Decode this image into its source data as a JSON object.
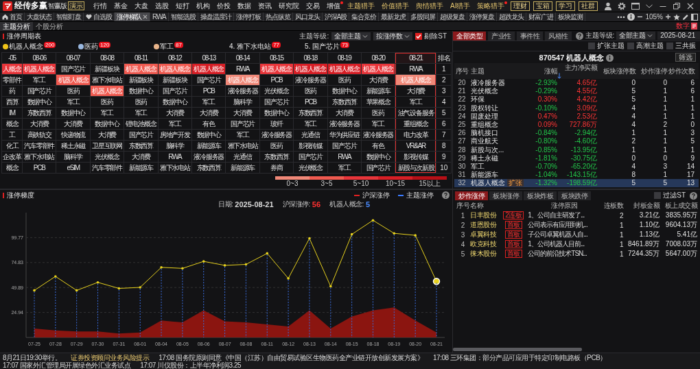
{
  "app": {
    "brand": "经传多赢",
    "edition": "智赢版",
    "demo": "演示"
  },
  "menu": [
    {
      "label": "行情",
      "gold": false,
      "dot": false
    },
    {
      "label": "基金",
      "gold": false,
      "dot": false
    },
    {
      "label": "大盘",
      "gold": false,
      "dot": false
    },
    {
      "label": "选股",
      "gold": false,
      "dot": false
    },
    {
      "label": "短打",
      "gold": false,
      "dot": false
    },
    {
      "label": "机构",
      "gold": false,
      "dot": false
    },
    {
      "label": "价投",
      "gold": false,
      "dot": false
    },
    {
      "label": "数据",
      "gold": false,
      "dot": false
    },
    {
      "label": "资讯",
      "gold": false,
      "dot": false
    },
    {
      "label": "研究院",
      "gold": false,
      "dot": false
    },
    {
      "label": "交易",
      "gold": false,
      "dot": false
    },
    {
      "label": "增值",
      "gold": false,
      "dot": true
    },
    {
      "label": "主题猎手",
      "gold": true,
      "dot": false
    },
    {
      "label": "价值猎手",
      "gold": true,
      "dot": false
    },
    {
      "label": "舆情猎手",
      "gold": true,
      "dot": false
    },
    {
      "label": "AI猎手",
      "gold": true,
      "dot": false
    },
    {
      "label": "策略猎手",
      "gold": true,
      "dot": true
    }
  ],
  "header_buttons": [
    "理财",
    "宝箱",
    "学习",
    "社群"
  ],
  "tabs": [
    {
      "label": "首页",
      "kind": "home",
      "selected": false
    },
    {
      "label": "大盘状态",
      "kind": "plain",
      "selected": false
    },
    {
      "label": "智能盯盘",
      "kind": "plain",
      "selected": false
    },
    {
      "label": "自选股",
      "kind": "heart",
      "selected": false
    },
    {
      "label": "涨停梯队",
      "kind": "plain",
      "selected": true
    },
    {
      "label": "RWA",
      "kind": "plain",
      "selected": false
    },
    {
      "label": "智能选股",
      "kind": "plain",
      "selected": false
    },
    {
      "label": "操盘温度计",
      "kind": "plain",
      "selected": false
    },
    {
      "label": "涨停打板",
      "kind": "plain",
      "selected": false
    },
    {
      "label": "热点纵览",
      "kind": "plain",
      "selected": false
    },
    {
      "label": "风口龙头",
      "kind": "plain",
      "selected": false
    },
    {
      "label": "沪深A股",
      "kind": "plain",
      "selected": false
    },
    {
      "label": "集合竞价",
      "kind": "plain",
      "selected": false
    },
    {
      "label": "最新龙虎",
      "kind": "plain",
      "selected": false
    },
    {
      "label": "多股同屏",
      "kind": "plain",
      "selected": false
    },
    {
      "label": "超级复盘",
      "kind": "plain",
      "selected": false
    },
    {
      "label": "涨停复盘",
      "kind": "plain",
      "selected": false
    },
    {
      "label": "超跌龙头",
      "kind": "plain",
      "selected": false
    },
    {
      "label": "财富广进",
      "kind": "plain",
      "selected": false
    },
    {
      "label": "板块监测",
      "kind": "plain",
      "selected": false
    }
  ],
  "zoom": "105%",
  "subtabs": [
    {
      "label": "主题分析",
      "selected": true
    },
    {
      "label": "个股分析",
      "selected": false
    }
  ],
  "corner_link": "数字",
  "cycle_table": {
    "title": "涨停周期表",
    "filter_label": "主题等级:",
    "filters": [
      "全部主题",
      "按涨停数"
    ],
    "exclude_st": {
      "label": "剔除ST",
      "checked": true
    },
    "top_themes": [
      {
        "label": "机器人概念",
        "count": "200",
        "color": "#f0c419"
      },
      {
        "label": "医药",
        "count": "120",
        "color": "#9ab8e0"
      },
      {
        "label": "军工",
        "count": "87",
        "color": "#e8b48a"
      },
      {
        "label": "4. 雅下水电站",
        "count": "77"
      },
      {
        "label": "5. 国产芯片",
        "count": "73"
      }
    ],
    "columns": [
      {
        "label": "-05",
        "selected": false
      },
      {
        "label": "08-06",
        "selected": false
      },
      {
        "label": "08-07",
        "selected": false
      },
      {
        "label": "08-08",
        "selected": false
      },
      {
        "label": "08-11",
        "selected": false
      },
      {
        "label": "08-12",
        "selected": false
      },
      {
        "label": "08-13",
        "selected": false
      },
      {
        "label": "08-14",
        "selected": false
      },
      {
        "label": "08-15",
        "selected": false
      },
      {
        "label": "08-18",
        "selected": false
      },
      {
        "label": "08-19",
        "selected": false
      },
      {
        "label": "08-20",
        "selected": false
      },
      {
        "label": "08-21",
        "selected": true
      }
    ],
    "rank_header": "排名",
    "rows": [
      {
        "rank": "1",
        "cells": [
          {
            "text": "人概念",
            "color": "#e8353a"
          },
          {
            "text": "机器人概念",
            "color": "#e8353a"
          },
          {
            "text": "国产芯片"
          },
          {
            "text": "新疆板块"
          },
          {
            "text": "机器人概念",
            "color": "#f05a50"
          },
          {
            "text": "机器人概念",
            "color": "#f05a50"
          },
          {
            "text": "机器人概念",
            "color": "#d81e25"
          },
          {
            "text": "RWA"
          },
          {
            "text": "机器人概念",
            "color": "#e8353a"
          },
          {
            "text": "机器人概念",
            "color": "#d81e25"
          },
          {
            "text": "机器人概念",
            "color": "#d81e25"
          },
          {
            "text": "机器人概念",
            "color": "#e8353a"
          },
          {
            "text": "RWA"
          }
        ]
      },
      {
        "rank": "2",
        "cells": [
          {
            "text": "零部件"
          },
          {
            "text": "军工"
          },
          {
            "text": "机器人概念",
            "color": "#f05a50"
          },
          {
            "text": "雅下水电站"
          },
          {
            "text": "新疆板块"
          },
          {
            "text": "新疆板块"
          },
          {
            "text": "国产芯片"
          },
          {
            "text": "机器人概念",
            "color": "#f08878"
          },
          {
            "text": "PCB"
          },
          {
            "text": "液冷服务器"
          },
          {
            "text": "医药"
          },
          {
            "text": "大消费"
          },
          {
            "text": "机器人概念",
            "color": "#f08878"
          }
        ]
      },
      {
        "rank": "3",
        "cells": [
          {
            "text": "药"
          },
          {
            "text": "国产芯片"
          },
          {
            "text": "医药"
          },
          {
            "text": "机器人概念",
            "color": "#f05a50"
          },
          {
            "text": "数据中心"
          },
          {
            "text": "国产芯片"
          },
          {
            "text": "PCB"
          },
          {
            "text": "液冷服务器"
          },
          {
            "text": "光伏概念"
          },
          {
            "text": "医药"
          },
          {
            "text": "数据中心"
          },
          {
            "text": "新能源车"
          },
          {
            "text": "大消费"
          }
        ]
      },
      {
        "rank": "4",
        "cells": [
          {
            "text": "西算"
          },
          {
            "text": "数据中心"
          },
          {
            "text": "军工"
          },
          {
            "text": "医药"
          },
          {
            "text": "医药"
          },
          {
            "text": "数据中心"
          },
          {
            "text": "军工"
          },
          {
            "text": "脑科学"
          },
          {
            "text": "国产芯片"
          },
          {
            "text": "PCB"
          },
          {
            "text": "东数西算"
          },
          {
            "text": "苹果概念"
          },
          {
            "text": "军工"
          }
        ]
      },
      {
        "rank": "5",
        "cells": [
          {
            "text": "IM"
          },
          {
            "text": "东数西算"
          },
          {
            "text": "数据中心"
          },
          {
            "text": "军工"
          },
          {
            "text": "军工"
          },
          {
            "text": "大消费"
          },
          {
            "text": "大消费"
          },
          {
            "text": "大消费"
          },
          {
            "text": "数据中心"
          },
          {
            "text": "东数西算"
          },
          {
            "text": "大消费"
          },
          {
            "text": "医药"
          },
          {
            "text": "油气设备服务"
          }
        ]
      },
      {
        "rank": "6",
        "cells": [
          {
            "text": "概念"
          },
          {
            "text": "大消费"
          },
          {
            "text": "大消费"
          },
          {
            "text": "数据中心"
          },
          {
            "text": "锂电池概念"
          },
          {
            "text": "军工"
          },
          {
            "text": "有色"
          },
          {
            "text": "国产芯片"
          },
          {
            "text": "玻纤"
          },
          {
            "text": "军工"
          },
          {
            "text": "液冷服务器"
          },
          {
            "text": "军工"
          },
          {
            "text": "重组概念"
          }
        ]
      },
      {
        "rank": "7",
        "cells": [
          {
            "text": "工"
          },
          {
            "text": "高铁轨交"
          },
          {
            "text": "快递物流"
          },
          {
            "text": "大消费"
          },
          {
            "text": "国产芯片"
          },
          {
            "text": "房地产开发"
          },
          {
            "text": "数据中心"
          },
          {
            "text": "军工"
          },
          {
            "text": "液冷服务器"
          },
          {
            "text": "光通信"
          },
          {
            "text": "华为供应链"
          },
          {
            "text": "液冷服务器"
          },
          {
            "text": "电力改革"
          }
        ]
      },
      {
        "rank": "8",
        "cells": [
          {
            "text": "化工"
          },
          {
            "text": "汽车零部件"
          },
          {
            "text": "稀土永磁"
          },
          {
            "text": "卫星互联网"
          },
          {
            "text": "东数西算"
          },
          {
            "text": "脑科学"
          },
          {
            "text": "新能源车"
          },
          {
            "text": "雅下水电站"
          },
          {
            "text": "医药"
          },
          {
            "text": "影视传媒"
          },
          {
            "text": "国产芯片"
          },
          {
            "text": "有色"
          },
          {
            "text": "VR&AR"
          }
        ]
      },
      {
        "rank": "9",
        "cells": [
          {
            "text": "企改革"
          },
          {
            "text": "雅下水电站"
          },
          {
            "text": "脑科学"
          },
          {
            "text": "光伏概念"
          },
          {
            "text": "大消费"
          },
          {
            "text": "RWA"
          },
          {
            "text": "液冷服务器"
          },
          {
            "text": "光通信"
          },
          {
            "text": "东数西算"
          },
          {
            "text": "国产芯片"
          },
          {
            "text": "RWA"
          },
          {
            "text": "数据中心"
          },
          {
            "text": "影视传媒"
          }
        ]
      },
      {
        "rank": "10",
        "cells": [
          {
            "text": "概念"
          },
          {
            "text": "PCB"
          },
          {
            "text": "eSIM"
          },
          {
            "text": "汽车零部件"
          },
          {
            "text": "新能源车"
          },
          {
            "text": "雅下水电站"
          },
          {
            "text": "东数西算"
          },
          {
            "text": "新能源车"
          },
          {
            "text": "券商"
          },
          {
            "text": "光伏概念"
          },
          {
            "text": "军工"
          },
          {
            "text": "国产芯片"
          },
          {
            "text": "新股与次新股"
          }
        ]
      }
    ],
    "legend": [
      {
        "label": "0~3",
        "color": "#f08878"
      },
      {
        "label": "3~5",
        "color": "#f05a50"
      },
      {
        "label": "5~10",
        "color": "#e8353a"
      },
      {
        "label": "10~15",
        "color": "#d81e25"
      },
      {
        "label": "15以上",
        "color": "#b80f16"
      }
    ]
  },
  "theme_panel": {
    "types": [
      {
        "label": "全部类型",
        "selected": true
      },
      {
        "label": "产业性",
        "selected": false
      },
      {
        "label": "事件性",
        "selected": false
      },
      {
        "label": "风格性",
        "selected": false
      }
    ],
    "level_label": "主题等级:",
    "level": "全部主题",
    "date": "2025-08-21",
    "options": [
      {
        "label": "扩张主题",
        "checked": false
      },
      {
        "label": "高潮主题",
        "checked": false
      },
      {
        "label": "三共振",
        "checked": false
      }
    ],
    "title": "870547 机器人概念",
    "filter_button": "筛选",
    "columns": [
      {
        "label": "序号",
        "sorted": false
      },
      {
        "label": "主题",
        "sorted": false
      },
      {
        "label": "涨幅",
        "sorted": false
      },
      {
        "label": "主力净买额",
        "sorted": true
      },
      {
        "label": "板块涨停数",
        "sorted": false
      },
      {
        "label": "炒作涨停",
        "sorted": false
      },
      {
        "label": "炒作次数",
        "sorted": false
      }
    ],
    "rows": [
      {
        "no": "20",
        "name": "液冷服务器",
        "change": "-2.93%",
        "change_up": false,
        "net": "4.65亿",
        "net_up": true,
        "limit_ups": "0",
        "hype_limit": "0",
        "hype_count": "6",
        "selected": false
      },
      {
        "no": "21",
        "name": "光伏概念",
        "change": "-0.29%",
        "change_up": false,
        "net": "4.55亿",
        "net_up": true,
        "limit_ups": "5",
        "hype_limit": "1",
        "hype_count": "6",
        "selected": false
      },
      {
        "no": "22",
        "name": "环保",
        "change": "0.30%",
        "change_up": true,
        "net": "4.42亿",
        "net_up": true,
        "limit_ups": "5",
        "hype_limit": "1",
        "hype_count": "1",
        "selected": false
      },
      {
        "no": "23",
        "name": "股权转让",
        "change": "-0.10%",
        "change_up": false,
        "net": "3.09亿",
        "net_up": true,
        "limit_ups": "4",
        "hype_limit": "1",
        "hype_count": "1",
        "selected": false
      },
      {
        "no": "24",
        "name": "固废处理",
        "change": "0.47%",
        "change_up": true,
        "net": "2.53亿",
        "net_up": true,
        "limit_ups": "4",
        "hype_limit": "1",
        "hype_count": "1",
        "selected": false
      },
      {
        "no": "25",
        "name": "重组概念",
        "change": "0.09%",
        "change_up": true,
        "net": "727.86万",
        "net_up": true,
        "limit_ups": "4",
        "hype_limit": "2",
        "hype_count": "0",
        "selected": false
      },
      {
        "no": "26",
        "name": "脑机接口",
        "change": "-0.84%",
        "change_up": false,
        "net": "-2.94亿",
        "net_up": false,
        "limit_ups": "1",
        "hype_limit": "1",
        "hype_count": "3",
        "selected": false
      },
      {
        "no": "27",
        "name": "商业航天",
        "change": "-0.80%",
        "change_up": false,
        "net": "-4.60亿",
        "net_up": false,
        "limit_ups": "2",
        "hype_limit": "1",
        "hype_count": "5",
        "selected": false
      },
      {
        "no": "28",
        "name": "新股与次...",
        "change": "-0.85%",
        "change_up": false,
        "net": "-13.95亿",
        "net_up": false,
        "limit_ups": "1",
        "hype_limit": "1",
        "hype_count": "1",
        "selected": false
      },
      {
        "no": "29",
        "name": "稀土永磁",
        "change": "-1.81%",
        "change_up": false,
        "net": "-30.75亿",
        "net_up": false,
        "limit_ups": "0",
        "hype_limit": "0",
        "hype_count": "9",
        "selected": false
      },
      {
        "no": "30",
        "name": "军工",
        "change": "-0.70%",
        "change_up": false,
        "net": "-65.20亿",
        "net_up": false,
        "limit_ups": "4",
        "hype_limit": "3",
        "hype_count": "14",
        "selected": false
      },
      {
        "no": "31",
        "name": "新能源车",
        "change": "-1.04%",
        "change_up": false,
        "net": "-143.15亿",
        "net_up": false,
        "limit_ups": "8",
        "hype_limit": "1",
        "hype_count": "17",
        "selected": false
      },
      {
        "no": "32",
        "name": "机器人概念",
        "tag": "扩张",
        "change": "-1.32%",
        "change_up": false,
        "net": "-198.59亿",
        "net_up": false,
        "limit_ups": "5",
        "hype_limit": "5",
        "hype_count": "13",
        "selected": true
      }
    ]
  },
  "chart_panel": {
    "title": "涨停梯度",
    "legend": [
      {
        "color": "#e02020"
      },
      {
        "color": "#3a7bff"
      }
    ],
    "info": [
      {
        "label": "日期:",
        "value": "2025-08-21",
        "color": "#d8d8d8"
      },
      {
        "label": "沪深涨停:",
        "value": "56",
        "color": "#ff3030"
      },
      {
        "label": "机器人概念:",
        "value": "5",
        "color": "#4a8cff"
      }
    ],
    "chart_data": {
      "type": "line",
      "categories": [
        "07-25",
        "07-28",
        "07-29",
        "07-30",
        "07-31",
        "08-01",
        "08-04",
        "08-05",
        "08-06",
        "08-07",
        "08-08",
        "08-11",
        "08-12",
        "08-13",
        "08-14",
        "08-15",
        "08-18",
        "08-19",
        "08-20",
        "08-21"
      ],
      "grid": true,
      "series": [
        {
          "name": "沪深涨停",
          "color": "#e8d21d",
          "values": [
            47,
            61,
            47,
            55,
            49,
            50,
            70,
            69,
            76,
            72,
            73,
            84,
            59,
            99,
            51,
            103,
            117,
            104,
            102,
            56
          ]
        },
        {
          "name": "主题涨停",
          "type": "area",
          "color": "#8b1510",
          "values": [
            9,
            7,
            6,
            6,
            4,
            5,
            17,
            15,
            27,
            16,
            15,
            13,
            11,
            27,
            9,
            21,
            27,
            30,
            17,
            5
          ]
        }
      ],
      "ylim": [
        0,
        124.7
      ],
      "yticks": [
        24.94,
        49.89,
        74.83,
        99.77
      ]
    }
  },
  "limit_up_panel": {
    "tabs": [
      {
        "label": "炒作涨停",
        "selected": true
      },
      {
        "label": "板块涨停",
        "selected": false
      },
      {
        "label": "板块炸板",
        "selected": false
      },
      {
        "label": "板块跌停",
        "selected": false
      }
    ],
    "filter_st": {
      "label": "过滤ST",
      "checked": false
    },
    "columns": [
      "序号",
      "名称",
      "涨停原因",
      "连板数",
      "封板金额",
      "板上成交额"
    ],
    "rows": [
      {
        "no": "1",
        "name": "日丰股份",
        "tag": "2连板",
        "reason": "1、公司自主研发了...",
        "boards": "2",
        "seal": "3.21亿",
        "turnover": "3835.95万"
      },
      {
        "no": "2",
        "name": "道恩股份",
        "tag": "首板",
        "reason": "公司表示有应用到机...",
        "boards": "1",
        "seal": "1.10亿",
        "turnover": "9604.13万"
      },
      {
        "no": "3",
        "name": "卓翼科技",
        "tag": "首板",
        "reason": "子公司卓翼机器人自...",
        "boards": "1",
        "seal": "1.13亿",
        "turnover": "5.41亿"
      },
      {
        "no": "4",
        "name": "欧克科技",
        "tag": "首板",
        "reason": "1、公司机器人目前...",
        "boards": "1",
        "seal": "8461.89万",
        "turnover": "7008.03万"
      },
      {
        "no": "5",
        "name": "徕木股份",
        "tag": "首板",
        "reason": "公司的前沿技术TSN...",
        "boards": "1",
        "seal": "7244.35万",
        "turnover": "5647.00万"
      }
    ]
  },
  "ticker": [
    {
      "text": "8月21日19:30举行。",
      "highlight": false
    },
    {
      "text": "证券投资顾问业务风险提示",
      "highlight": true
    },
    {
      "text": "17:08 国务院原则同意《中国（江苏）自由贸易试验区生物医药全产业链开放创新发展方案》",
      "highlight": false
    },
    {
      "text": "17:08 三环集团：部分产品可应用于特定印制电路板（PCB）",
      "highlight": false
    },
    {
      "text": "17:07 国家外汇管理局开展绿色外汇业务试点",
      "highlight": false
    },
    {
      "text": "17:07 川仪股份：上半年净利润3.25",
      "highlight": false
    }
  ]
}
